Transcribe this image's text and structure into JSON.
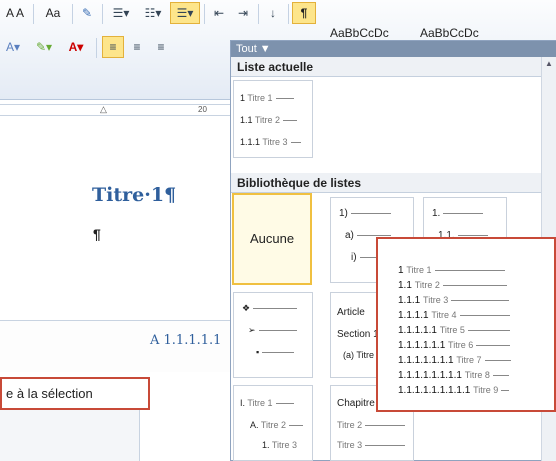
{
  "ribbon": {
    "font_size_label": "A A",
    "case_label": "Aa",
    "styles": [
      "AaBbCcDc",
      "AaBbCcDc"
    ],
    "ruler_mark": "20"
  },
  "document": {
    "heading": "Titre·1¶",
    "paragraph_mark": "¶"
  },
  "bottom": {
    "style_sample": "A 1.1.1.1.1",
    "apply_label": "e à la sélection"
  },
  "panel": {
    "header": "Tout",
    "current_list_title": "Liste actuelle",
    "current_list": [
      {
        "num": "1",
        "text": "Titre 1"
      },
      {
        "num": "1.1",
        "text": "Titre 2"
      },
      {
        "num": "1.1.1",
        "text": "Titre 3"
      }
    ],
    "library_title": "Bibliothèque de listes",
    "none_label": "Aucune",
    "tile2_lines": [
      "1)",
      "a)",
      "i)"
    ],
    "tile3_lines": [
      "1.",
      "1.1."
    ],
    "tile5_lines": [
      "Article",
      "Section 1",
      "(a) Titre 3"
    ],
    "tile6_lines": [
      {
        "num": "I.",
        "text": "Titre 1"
      },
      {
        "num": "A.",
        "text": "Titre 2"
      },
      {
        "num": "1.",
        "text": "Titre 3"
      }
    ],
    "tile7_lines": [
      "Chapitre",
      "Titre 2",
      "Titre 3"
    ]
  },
  "popup": {
    "lines": [
      {
        "num": "1",
        "text": "Titre 1"
      },
      {
        "num": "1.1",
        "text": "Titre 2"
      },
      {
        "num": "1.1.1",
        "text": "Titre 3"
      },
      {
        "num": "1.1.1.1",
        "text": "Titre 4"
      },
      {
        "num": "1.1.1.1.1",
        "text": "Titre 5"
      },
      {
        "num": "1.1.1.1.1.1",
        "text": "Titre 6"
      },
      {
        "num": "1.1.1.1.1.1.1",
        "text": "Titre 7"
      },
      {
        "num": "1.1.1.1.1.1.1.1",
        "text": "Titre 8"
      },
      {
        "num": "1.1.1.1.1.1.1.1.1",
        "text": "Titre 9"
      }
    ]
  }
}
